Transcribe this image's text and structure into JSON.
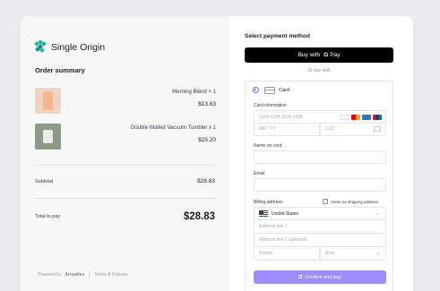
{
  "brand": {
    "name": "Single Origin",
    "color": "#19b6a3"
  },
  "summary": {
    "title": "Order summary",
    "items": [
      {
        "name": "Morning Blend × 1",
        "price": "$13.63",
        "thumb_color": "#efd3c3"
      },
      {
        "name": "Double Walled Vacuum Tumbler x 1",
        "price": "$25.20",
        "thumb_color": "#8d9a86"
      }
    ],
    "subtotal_label": "Subtotal",
    "subtotal_value": "$28.83",
    "total_label": "Total to pay",
    "total_value": "$28.83"
  },
  "footer": {
    "powered_by": "Powered by",
    "provider": "Airwallex",
    "terms": "Terms & Policies"
  },
  "payment": {
    "title": "Select payment method",
    "gpay": {
      "buy_with": "Buy with",
      "g": "G",
      "pay": "Pay"
    },
    "or_pay_with": "Or pay with",
    "card_label": "Card",
    "card_info_label": "Card information",
    "card_number_placeholder": "1234 1234 1234 1234",
    "expiry_placeholder": "MM / YY",
    "cvc_placeholder": "CVC",
    "name_label": "Name on card",
    "email_label": "Email",
    "billing_label": "Billing address",
    "same_as_shipping": "Same as shipping address",
    "country": "United States",
    "address1_placeholder": "Address line 1",
    "address2_placeholder": "Address line 2 (optional)",
    "district_placeholder": "District",
    "area_placeholder": "Area",
    "confirm_label": "Confirm and pay",
    "accent_color": "#7b61ff"
  },
  "icons": [
    "brand-logo-icon",
    "card-icon",
    "visa-icon",
    "mastercard-icon",
    "amex-icon",
    "unionpay-icon",
    "cvc-icon",
    "us-flag-icon",
    "chevron-down-icon",
    "lock-icon"
  ]
}
